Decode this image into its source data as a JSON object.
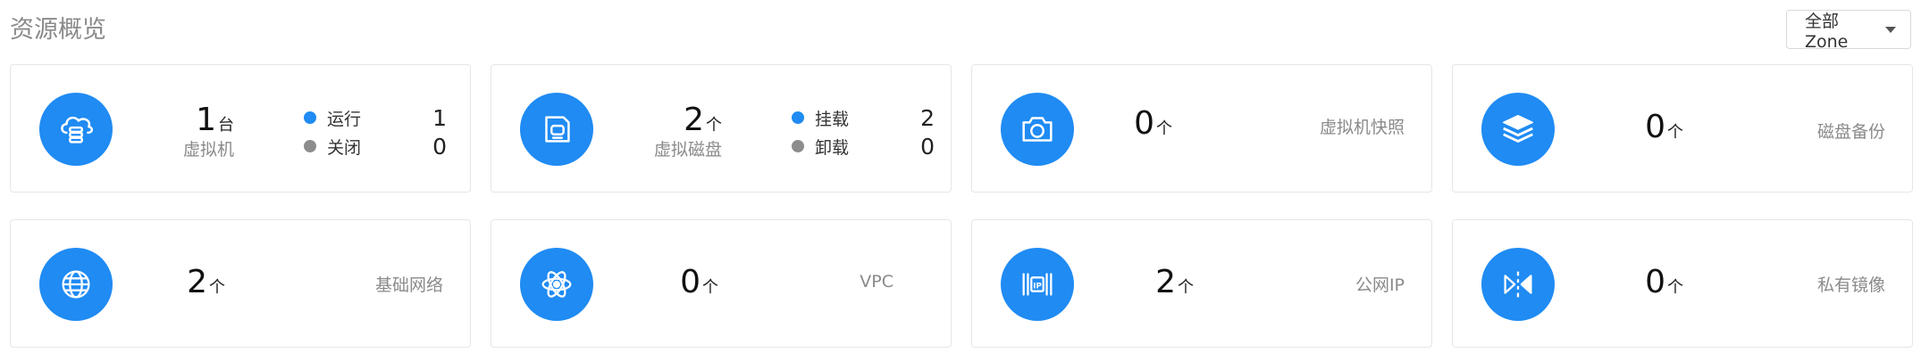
{
  "header": {
    "title": "资源概览",
    "zone_select": {
      "selected": "全部Zone"
    }
  },
  "colors": {
    "accent": "#1f8bf3",
    "dot_running": "#1f8bf3",
    "dot_stopped": "#8c8c8c"
  },
  "cards": {
    "vm": {
      "count": "1",
      "unit": "台",
      "label": "虚拟机",
      "icon": "cloud-server-icon",
      "status": [
        {
          "label": "运行",
          "value": "1"
        },
        {
          "label": "关闭",
          "value": "0"
        }
      ]
    },
    "disk": {
      "count": "2",
      "unit": "个",
      "label": "虚拟磁盘",
      "icon": "disk-icon",
      "status": [
        {
          "label": "挂载",
          "value": "2"
        },
        {
          "label": "卸载",
          "value": "0"
        }
      ]
    },
    "snapshot": {
      "count": "0",
      "unit": "个",
      "label": "虚拟机快照",
      "icon": "camera-icon"
    },
    "backup": {
      "count": "0",
      "unit": "个",
      "label": "磁盘备份",
      "icon": "layers-icon"
    },
    "network": {
      "count": "2",
      "unit": "个",
      "label": "基础网络",
      "icon": "globe-icon"
    },
    "vpc": {
      "count": "0",
      "unit": "个",
      "label": "VPC",
      "icon": "atom-icon"
    },
    "public_ip": {
      "count": "2",
      "unit": "个",
      "label": "公网IP",
      "icon": "ip-icon",
      "icon_text": "IP"
    },
    "image": {
      "count": "0",
      "unit": "个",
      "label": "私有镜像",
      "icon": "mirror-icon"
    }
  }
}
